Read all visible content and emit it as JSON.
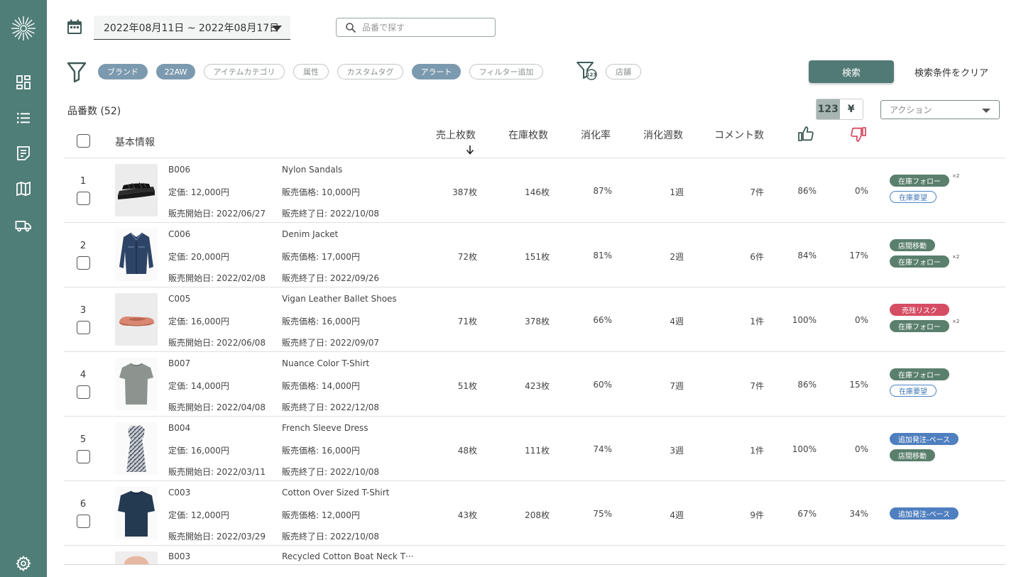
{
  "date_range": "2022年08月11日 ~ 2022年08月17日",
  "search": {
    "placeholder": "品番で探す",
    "value": ""
  },
  "filters": [
    {
      "label": "ブランド",
      "style": "filled"
    },
    {
      "label": "22AW",
      "style": "filled"
    },
    {
      "label": "アイテムカテゴリ",
      "style": "outline"
    },
    {
      "label": "属性",
      "style": "outline"
    },
    {
      "label": "カスタムタグ",
      "style": "outline"
    },
    {
      "label": "アラート",
      "style": "filled"
    },
    {
      "label": "フィルター追加",
      "style": "outline"
    }
  ],
  "store_filter": {
    "badge": "123",
    "label": "店舗"
  },
  "buttons": {
    "search": "検索",
    "clear": "検索条件をクリア"
  },
  "count_label": "品番数 (52)",
  "unit_toggle": {
    "options": [
      "123",
      "¥"
    ],
    "active": "123"
  },
  "action_select": {
    "placeholder": "アクション"
  },
  "columns": {
    "basic_info": "基本情報",
    "units_sold": "売上枚数",
    "stock": "在庫枚数",
    "sell_through": "消化率",
    "weeks": "消化週数",
    "comments": "コメント数"
  },
  "colors": {
    "sidebar": "#4f7d78",
    "primary_button": "#517a76",
    "chip_filled": "#7c9aaf",
    "tag_green": "#5a7f6d",
    "tag_red": "#d54d63",
    "tag_blue": "#4f7fbf",
    "dislike": "#d54d63"
  },
  "rows": [
    {
      "rank": "1",
      "code": "B006",
      "name": "Nylon Sandals",
      "list_price": "定価: 12,000円",
      "sale_price": "販売価格: 10,000円",
      "start": "販売開始日: 2022/06/27",
      "end": "販売終了日: 2022/10/08",
      "sold": "387枚",
      "stock": "146枚",
      "rate": "87%",
      "weeks": "1週",
      "comments": "7件",
      "like": "86%",
      "dislike": "0%",
      "image": "sandals",
      "tags": [
        {
          "label": "在庫フォロー",
          "style": "green",
          "mult": "×2"
        },
        {
          "label": "在庫要望",
          "style": "outline-blue"
        }
      ]
    },
    {
      "rank": "2",
      "code": "C006",
      "name": "Denim Jacket",
      "list_price": "定価: 20,000円",
      "sale_price": "販売価格: 17,000円",
      "start": "販売開始日: 2022/02/08",
      "end": "販売終了日: 2022/09/26",
      "sold": "72枚",
      "stock": "151枚",
      "rate": "81%",
      "weeks": "2週",
      "comments": "6件",
      "like": "84%",
      "dislike": "17%",
      "image": "jacket",
      "tags": [
        {
          "label": "店間移動",
          "style": "green"
        },
        {
          "label": "在庫フォロー",
          "style": "green",
          "mult": "×2"
        }
      ]
    },
    {
      "rank": "3",
      "code": "C005",
      "name": "Vigan Leather Ballet Shoes",
      "list_price": "定価: 16,000円",
      "sale_price": "販売価格: 16,000円",
      "start": "販売開始日: 2022/06/08",
      "end": "販売終了日: 2022/09/07",
      "sold": "71枚",
      "stock": "378枚",
      "rate": "66%",
      "weeks": "4週",
      "comments": "1件",
      "like": "100%",
      "dislike": "0%",
      "image": "shoes",
      "tags": [
        {
          "label": "売残リスク",
          "style": "red"
        },
        {
          "label": "在庫フォロー",
          "style": "green",
          "mult": "×2"
        }
      ]
    },
    {
      "rank": "4",
      "code": "B007",
      "name": "Nuance Color T-Shirt",
      "list_price": "定価: 14,000円",
      "sale_price": "販売価格: 14,000円",
      "start": "販売開始日: 2022/04/08",
      "end": "販売終了日: 2022/12/08",
      "sold": "51枚",
      "stock": "423枚",
      "rate": "60%",
      "weeks": "7週",
      "comments": "7件",
      "like": "86%",
      "dislike": "15%",
      "image": "tshirt",
      "tags": [
        {
          "label": "在庫フォロー",
          "style": "green"
        },
        {
          "label": "在庫要望",
          "style": "outline-blue"
        }
      ]
    },
    {
      "rank": "5",
      "code": "B004",
      "name": "French Sleeve Dress",
      "list_price": "定価: 16,000円",
      "sale_price": "販売価格: 16,000円",
      "start": "販売開始日: 2022/03/11",
      "end": "販売終了日: 2022/10/08",
      "sold": "48枚",
      "stock": "111枚",
      "rate": "74%",
      "weeks": "3週",
      "comments": "1件",
      "like": "100%",
      "dislike": "0%",
      "image": "dress",
      "tags": [
        {
          "label": "追加発注-ペース",
          "style": "blue"
        },
        {
          "label": "店間移動",
          "style": "green"
        }
      ]
    },
    {
      "rank": "6",
      "code": "C003",
      "name": "Cotton Over Sized T-Shirt",
      "list_price": "定価: 12,000円",
      "sale_price": "販売価格: 12,000円",
      "start": "販売開始日: 2022/03/29",
      "end": "販売終了日: 2022/10/08",
      "sold": "43枚",
      "stock": "208枚",
      "rate": "75%",
      "weeks": "4週",
      "comments": "9件",
      "like": "67%",
      "dislike": "34%",
      "image": "navytee",
      "tags": [
        {
          "label": "追加発注-ペース",
          "style": "blue"
        }
      ]
    }
  ],
  "partial_row": {
    "code": "B003",
    "name": "Recycled Cotton Boat Neck T···"
  }
}
